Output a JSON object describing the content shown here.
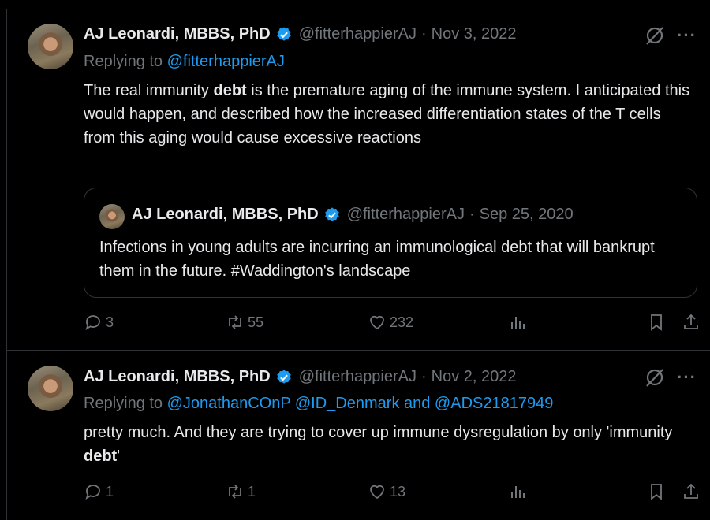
{
  "tweets": [
    {
      "author_name": "AJ Leonardi, MBBS, PhD",
      "handle": "@fitterhappierAJ",
      "separator": "·",
      "date": "Nov 3, 2022",
      "more": "···",
      "replying_label": "Replying to",
      "replying_mentions": "@fitterhappierAJ",
      "text_parts": [
        "The real immunity ",
        "debt",
        " is the premature aging of the immune system. I anticipated this would happen, and described how the increased differentiation states of the T cells from this aging would cause excessive reactions"
      ],
      "quote": {
        "author_name": "AJ Leonardi, MBBS, PhD",
        "handle": "@fitterhappierAJ",
        "separator": "·",
        "date": "Sep 25, 2020",
        "text": "Infections in young adults are incurring an immunological debt that will bankrupt them in the future. #Waddington's landscape"
      },
      "stats": {
        "replies": "3",
        "reposts": "55",
        "likes": "232"
      }
    },
    {
      "author_name": "AJ Leonardi, MBBS, PhD",
      "handle": "@fitterhappierAJ",
      "separator": "·",
      "date": "Nov 2, 2022",
      "more": "···",
      "replying_label": "Replying to",
      "replying_mentions": "@JonathanCOnP @ID_Denmark and @ADS21817949",
      "text_parts": [
        "pretty much. And they are trying to cover up immune dysregulation by only 'immunity ",
        "debt",
        "'"
      ],
      "stats": {
        "replies": "1",
        "reposts": "1",
        "likes": "13"
      }
    }
  ],
  "icons": {
    "verified": "verified-badge-icon",
    "grok": "grok-icon",
    "reply": "reply-icon",
    "repost": "repost-icon",
    "like": "heart-icon",
    "views": "views-icon",
    "bookmark": "bookmark-icon",
    "share": "share-icon"
  },
  "colors": {
    "background": "#000000",
    "text": "#e7e9ea",
    "muted": "#71767b",
    "link": "#1d9bf0",
    "border": "#2f3336"
  }
}
